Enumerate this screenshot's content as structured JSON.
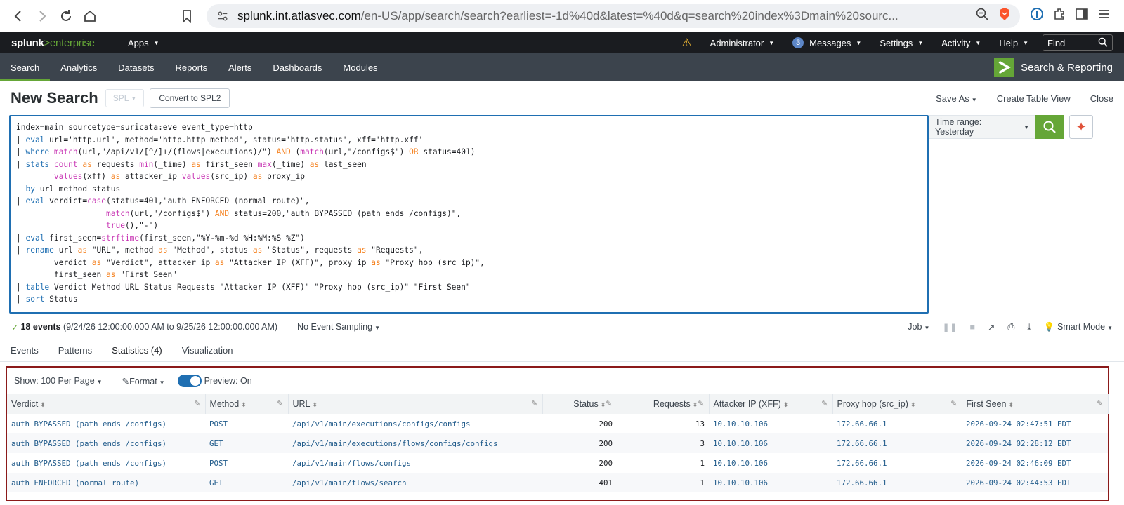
{
  "browser": {
    "url_host": "splunk.int.atlasvec.com",
    "url_path": "/en-US/app/search/search?earliest=-1d%40d&latest=%40d&q=search%20index%3Dmain%20sourc..."
  },
  "topbar": {
    "logo_main": "splunk",
    "logo_gt": ">",
    "logo_ent": "enterprise",
    "apps": "Apps",
    "administrator": "Administrator",
    "messages_count": "3",
    "messages": "Messages",
    "settings": "Settings",
    "activity": "Activity",
    "help": "Help",
    "find": "Find"
  },
  "appnav": {
    "tabs": [
      "Search",
      "Analytics",
      "Datasets",
      "Reports",
      "Alerts",
      "Dashboards",
      "Modules"
    ],
    "app_title": "Search & Reporting"
  },
  "search_header": {
    "title": "New Search",
    "spl": "SPL",
    "convert": "Convert to SPL2",
    "save_as": "Save As",
    "create_table": "Create Table View",
    "close": "Close"
  },
  "time_range": "Time range: Yesterday",
  "status": {
    "events": "18 events",
    "range": "(9/24/26 12:00:00.000 AM to 9/25/26 12:00:00.000 AM)",
    "sampling": "No Event Sampling",
    "job": "Job",
    "mode": "Smart Mode"
  },
  "result_tabs": [
    "Events",
    "Patterns",
    "Statistics (4)",
    "Visualization"
  ],
  "results_toolbar": {
    "show": "Show: 100 Per Page",
    "format": "Format",
    "preview": "Preview: On"
  },
  "table": {
    "columns": [
      "Verdict",
      "Method",
      "URL",
      "Status",
      "Requests",
      "Attacker IP (XFF)",
      "Proxy hop (src_ip)",
      "First Seen"
    ],
    "rows": [
      [
        "auth BYPASSED (path ends /configs)",
        "POST",
        "/api/v1/main/executions/configs/configs",
        "200",
        "13",
        "10.10.10.106",
        "172.66.66.1",
        "2026-09-24 02:47:51 EDT"
      ],
      [
        "auth BYPASSED (path ends /configs)",
        "GET",
        "/api/v1/main/executions/flows/configs/configs",
        "200",
        "3",
        "10.10.10.106",
        "172.66.66.1",
        "2026-09-24 02:28:12 EDT"
      ],
      [
        "auth BYPASSED (path ends /configs)",
        "POST",
        "/api/v1/main/flows/configs",
        "200",
        "1",
        "10.10.10.106",
        "172.66.66.1",
        "2026-09-24 02:46:09 EDT"
      ],
      [
        "auth ENFORCED (normal route)",
        "GET",
        "/api/v1/main/flows/search",
        "401",
        "1",
        "10.10.10.106",
        "172.66.66.1",
        "2026-09-24 02:44:53 EDT"
      ]
    ]
  },
  "query_lines": [
    "index=main sourcetype=suricata:eve event_type=http",
    "| eval url='http.url', method='http.http_method', status='http.status', xff='http.xff'",
    "| where match(url,\"/api/v1/[^/]+/(flows|executions)/\") AND (match(url,\"/configs$\") OR status=401)",
    "| stats count as requests min(_time) as first_seen max(_time) as last_seen",
    "        values(xff) as attacker_ip values(src_ip) as proxy_ip",
    "  by url method status",
    "| eval verdict=case(status=401,\"auth ENFORCED (normal route)\",",
    "                   match(url,\"/configs$\") AND status=200,\"auth BYPASSED (path ends /configs)\",",
    "                   true(),\"-\")",
    "| eval first_seen=strftime(first_seen,\"%Y-%m-%d %H:%M:%S %Z\")",
    "| rename url as \"URL\", method as \"Method\", status as \"Status\", requests as \"Requests\",",
    "        verdict as \"Verdict\", attacker_ip as \"Attacker IP (XFF)\", proxy_ip as \"Proxy hop (src_ip)\",",
    "        first_seen as \"First Seen\"",
    "| table Verdict Method URL Status Requests \"Attacker IP (XFF)\" \"Proxy hop (src_ip)\" \"First Seen\"",
    "| sort Status"
  ]
}
